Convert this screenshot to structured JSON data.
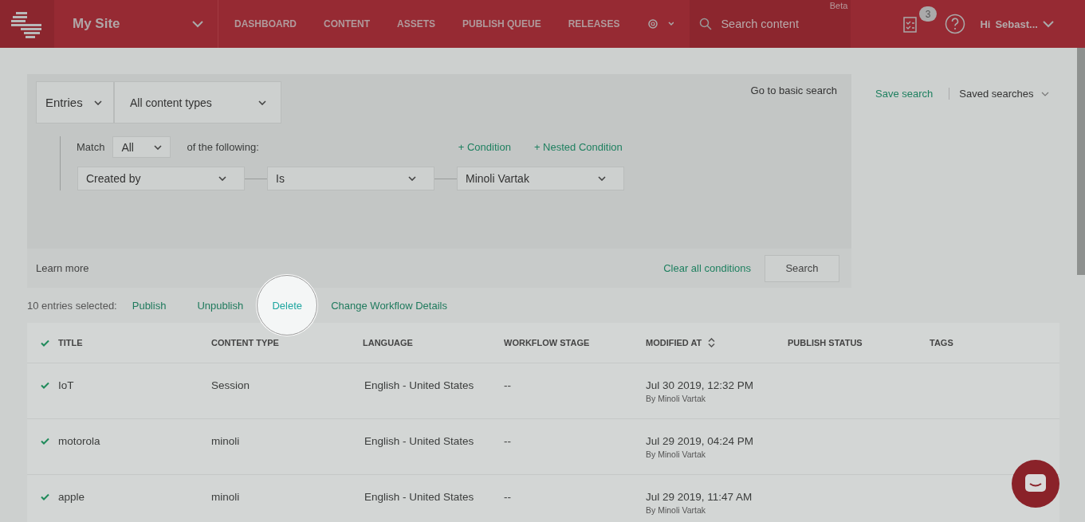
{
  "header": {
    "site": "My Site",
    "nav": [
      {
        "label": "DASHBOARD"
      },
      {
        "label": "CONTENT"
      },
      {
        "label": "ASSETS"
      },
      {
        "label": "PUBLISH QUEUE"
      },
      {
        "label": "RELEASES"
      }
    ],
    "search": {
      "placeholder": "Search content",
      "badge": "Beta"
    },
    "tasks_count": "3",
    "greeting": "Hi",
    "user": "Sebast..."
  },
  "search_panel": {
    "entity": "Entries",
    "content_type": "All content types",
    "basic_link": "Go to basic search",
    "match_label": "Match",
    "match": "All",
    "following": "of the following:",
    "add_condition": "+ Condition",
    "add_nested": "+ Nested Condition",
    "condition": {
      "field": "Created by",
      "operator": "Is",
      "value": "Minoli Vartak"
    },
    "learn_more": "Learn more",
    "clear": "Clear all conditions",
    "search_button": "Search"
  },
  "saved": {
    "save": "Save search",
    "saved": "Saved searches"
  },
  "bulk": {
    "count": "10 entries selected:",
    "actions": [
      {
        "label": "Publish",
        "highlighted": false
      },
      {
        "label": "Unpublish",
        "highlighted": false
      },
      {
        "label": "Delete",
        "highlighted": true
      },
      {
        "label": "Change Workflow Details",
        "highlighted": false
      }
    ]
  },
  "table": {
    "all_checked": true,
    "columns": [
      "TITLE",
      "CONTENT TYPE",
      "LANGUAGE",
      "WORKFLOW STAGE",
      "MODIFIED AT",
      "PUBLISH STATUS",
      "TAGS"
    ],
    "rows": [
      {
        "checked": true,
        "title": "IoT",
        "type": "Session",
        "language": "English - United States",
        "stage": "--",
        "modified": "Jul 30 2019, 12:32 PM",
        "by": "By Minoli Vartak"
      },
      {
        "checked": true,
        "title": "motorola",
        "type": "minoli",
        "language": "English - United States",
        "stage": "--",
        "modified": "Jul 29 2019, 04:24 PM",
        "by": "By Minoli Vartak"
      },
      {
        "checked": true,
        "title": "apple",
        "type": "minoli",
        "language": "English - United States",
        "stage": "--",
        "modified": "Jul 29 2019, 11:47 AM",
        "by": "By Minoli Vartak"
      }
    ]
  }
}
